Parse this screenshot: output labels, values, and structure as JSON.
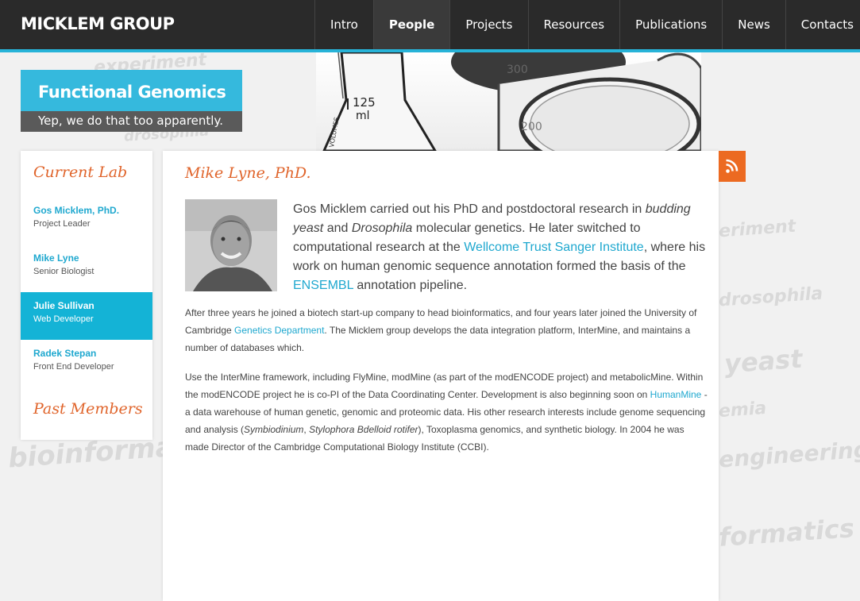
{
  "brand": "MICKLEM GROUP",
  "nav": [
    {
      "label": "Intro",
      "active": false
    },
    {
      "label": "People",
      "active": true
    },
    {
      "label": "Projects",
      "active": false
    },
    {
      "label": "Resources",
      "active": false
    },
    {
      "label": "Publications",
      "active": false
    },
    {
      "label": "News",
      "active": false
    },
    {
      "label": "Contacts",
      "active": false
    }
  ],
  "banner": {
    "title": "Functional Genomics",
    "subtitle": "Yep, we do that too apparently."
  },
  "sidebar": {
    "current_heading": "Current Lab",
    "past_heading": "Past Members",
    "members": [
      {
        "name": "Gos Micklem, PhD.",
        "role": "Project Leader"
      },
      {
        "name": "Mike Lyne",
        "role": "Senior Biologist"
      },
      {
        "name": "Julie Sullivan",
        "role": "Web Developer"
      },
      {
        "name": "Radek Stepan",
        "role": "Front End Developer"
      }
    ]
  },
  "background_words": [
    "experiment",
    "drosophila",
    "bioinformatics",
    "eriment",
    "drosophila",
    "yeast",
    "emia",
    "engineering",
    "formatics"
  ],
  "hero": {
    "flask_text": "VOLUMES",
    "flask_mark": "125",
    "flask_unit": "ml",
    "beaker_mark_1": "300",
    "beaker_mark_2": "200"
  },
  "content": {
    "title": "Mike Lyne, PhD.",
    "intro": {
      "t1": "Gos Micklem carried out his PhD and postdoctoral research in ",
      "em1": "budding yeast",
      "t2": " and ",
      "em2": "Drosophila",
      "t3": " molecular genetics. He later switched to computational research at the ",
      "link1": "Wellcome Trust Sanger Institute",
      "t4": ", where his work on human genomic sequence annotation formed the basis of the ",
      "link2": "ENSEMBL",
      "t5": " annotation pipeline."
    },
    "para2": {
      "t1": "After three years he joined a biotech start-up company to head bioinformatics, and four years later joined the University of Cambridge ",
      "link": "Genetics Department",
      "t2": ". The Micklem group develops the data integration platform, InterMine, and maintains a number of databases which."
    },
    "para3": {
      "t1": "Use the InterMine framework, including FlyMine, modMine (as part of the modENCODE project) and metabolicMine. Within the modENCODE project he is co-PI of the Data Coordinating Center. Development is also beginning soon on ",
      "link": "HumanMine",
      "t2": " - a data warehouse of human genetic, genomic and proteomic data. His other research interests include genome sequencing and analysis (",
      "em1": "Symbiodinium",
      "t3": ", ",
      "em2": "Stylophora Bdelloid rotifer",
      "t4": "), Toxoplasma genomics, and synthetic biology. In 2004 he was made Director of the Cambridge Computational Biology Institute (CCBI)."
    }
  },
  "colors": {
    "nav_bg": "#2a2a2a",
    "accent": "#27b3d8",
    "heading_orange": "#e0652c",
    "link_blue": "#1fa8cf",
    "rss_orange": "#ec6a21"
  },
  "icons": {
    "rss": "rss-icon"
  }
}
